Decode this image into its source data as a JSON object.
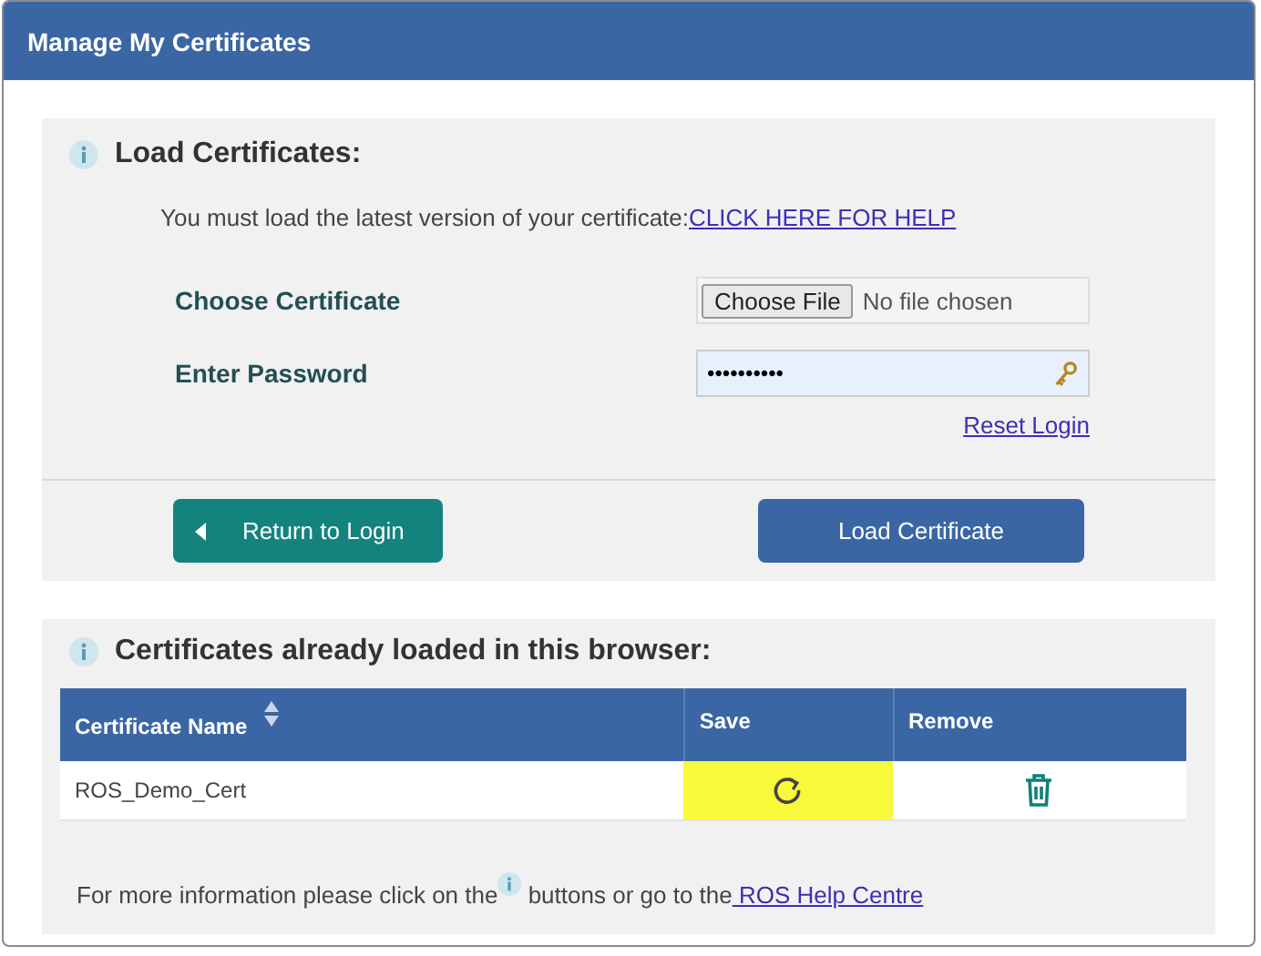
{
  "window": {
    "title": "Manage My Certificates"
  },
  "load_section": {
    "heading": "Load Certificates:",
    "notice": "You must load the latest version of your certificate:",
    "help_link": "CLICK HERE FOR HELP",
    "fields": [
      {
        "kind": "file",
        "label": "Choose Certificate",
        "button": "Choose File",
        "value": "No file chosen"
      },
      {
        "kind": "password",
        "label": "Enter Password",
        "value": "••••••••••"
      }
    ],
    "reset_link": "Reset Login",
    "buttons": [
      {
        "kind": "back",
        "label": "Return to Login"
      },
      {
        "kind": "primary",
        "label": "Load Certificate"
      }
    ]
  },
  "loaded_section": {
    "heading": "Certificates already loaded in this browser:",
    "table": {
      "columns": [
        {
          "label": "Certificate Name",
          "sortable": true
        },
        {
          "label": "Save"
        },
        {
          "label": "Remove"
        }
      ],
      "rows": [
        {
          "name": "ROS_Demo_Cert",
          "save_highlighted": true
        }
      ]
    },
    "footer": {
      "before": "For more information please click on the",
      "after": " buttons or go to the",
      "link": " ROS Help Centre"
    }
  }
}
